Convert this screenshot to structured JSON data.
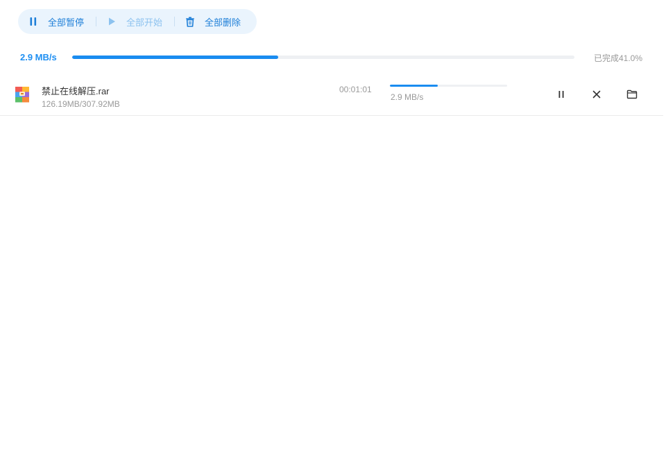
{
  "toolbar": {
    "pause_all": {
      "label": "全部暂停",
      "icon": "pause-icon",
      "state": "active"
    },
    "start_all": {
      "label": "全部开始",
      "icon": "play-icon",
      "state": "disabled"
    },
    "delete_all": {
      "label": "全部删除",
      "icon": "trash-icon",
      "state": "active"
    }
  },
  "global": {
    "speed": "2.9 MB/s",
    "progress_percent": 41.0,
    "completed_text": "已完成41.0%"
  },
  "downloads": [
    {
      "file_name": "禁止在线解压.rar",
      "size_text": "126.19MB/307.92MB",
      "elapsed": "00:01:01",
      "progress_percent": 41.0,
      "speed": "2.9 MB/s",
      "file_icon": "rar-archive-icon",
      "actions": [
        "pause-icon",
        "close-icon",
        "folder-icon"
      ]
    }
  ],
  "colors": {
    "accent": "#1a8cf0",
    "toolbar_bg": "#eaf4fd",
    "disabled": "#8cc2ef",
    "muted_text": "#999999"
  }
}
